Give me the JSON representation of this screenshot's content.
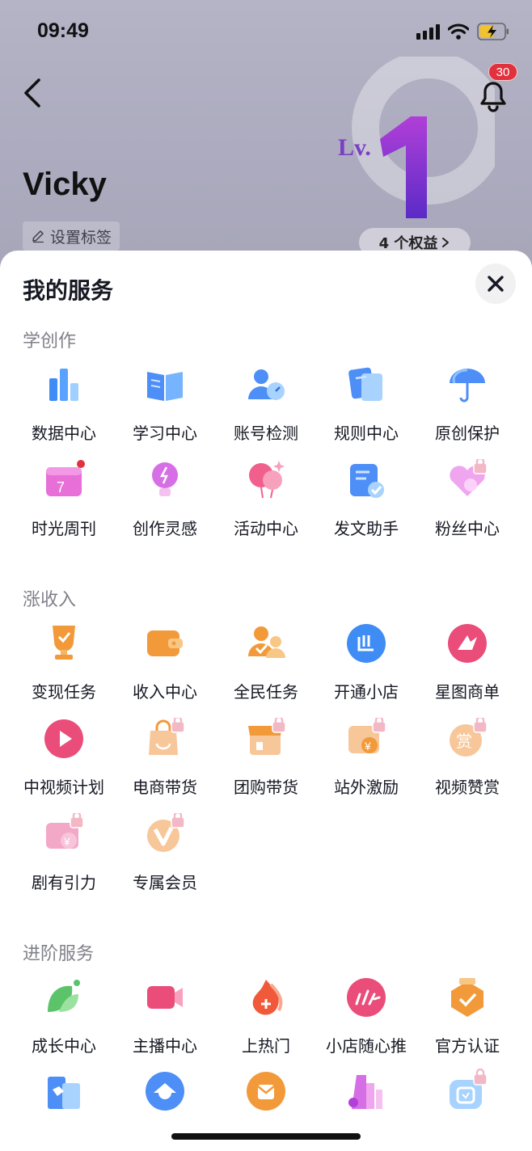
{
  "status_bar": {
    "time": "09:49"
  },
  "header": {
    "username": "Vicky",
    "tag_button_label": "设置标签",
    "notification_count": "30",
    "level_prefix": "Lv.",
    "level_number": "1",
    "rights_label": "4 个权益"
  },
  "sheet": {
    "title": "我的服务",
    "sections": [
      {
        "title": "学创作",
        "items": [
          {
            "label": "数据中心",
            "icon": "data-center-icon"
          },
          {
            "label": "学习中心",
            "icon": "learning-center-icon"
          },
          {
            "label": "账号检测",
            "icon": "account-check-icon"
          },
          {
            "label": "规则中心",
            "icon": "rules-center-icon"
          },
          {
            "label": "原创保护",
            "icon": "originality-protection-icon"
          },
          {
            "label": "时光周刊",
            "icon": "weekly-calendar-icon",
            "has_dot": true
          },
          {
            "label": "创作灵感",
            "icon": "inspiration-bulb-icon"
          },
          {
            "label": "活动中心",
            "icon": "activity-balloon-icon"
          },
          {
            "label": "发文助手",
            "icon": "post-assistant-icon"
          },
          {
            "label": "粉丝中心",
            "icon": "fans-center-icon",
            "locked": true
          }
        ]
      },
      {
        "title": "涨收入",
        "items": [
          {
            "label": "变现任务",
            "icon": "monetize-trophy-icon"
          },
          {
            "label": "收入中心",
            "icon": "income-wallet-icon"
          },
          {
            "label": "全民任务",
            "icon": "public-task-icon"
          },
          {
            "label": "开通小店",
            "icon": "open-shop-icon"
          },
          {
            "label": "星图商单",
            "icon": "star-map-icon"
          },
          {
            "label": "中视频计划",
            "icon": "medium-video-icon"
          },
          {
            "label": "电商带货",
            "icon": "ecommerce-bag-icon",
            "locked": true
          },
          {
            "label": "团购带货",
            "icon": "group-buy-icon",
            "locked": true
          },
          {
            "label": "站外激励",
            "icon": "offsite-incentive-icon",
            "locked": true
          },
          {
            "label": "视频赞赏",
            "icon": "video-tip-icon",
            "locked": true
          },
          {
            "label": "剧有引力",
            "icon": "drama-gravity-icon",
            "locked": true
          },
          {
            "label": "专属会员",
            "icon": "exclusive-member-icon",
            "locked": true
          }
        ]
      },
      {
        "title": "进阶服务",
        "items": [
          {
            "label": "成长中心",
            "icon": "growth-leaf-icon"
          },
          {
            "label": "主播中心",
            "icon": "anchor-camera-icon"
          },
          {
            "label": "上热门",
            "icon": "trending-flame-icon"
          },
          {
            "label": "小店随心推",
            "icon": "shop-promote-icon"
          },
          {
            "label": "官方认证",
            "icon": "official-verify-icon"
          }
        ]
      }
    ]
  },
  "colors": {
    "sheet_bg": "#ffffff",
    "header_bg": "#aeadc0",
    "badge_red": "#e0313d",
    "section_title": "#80808a"
  }
}
